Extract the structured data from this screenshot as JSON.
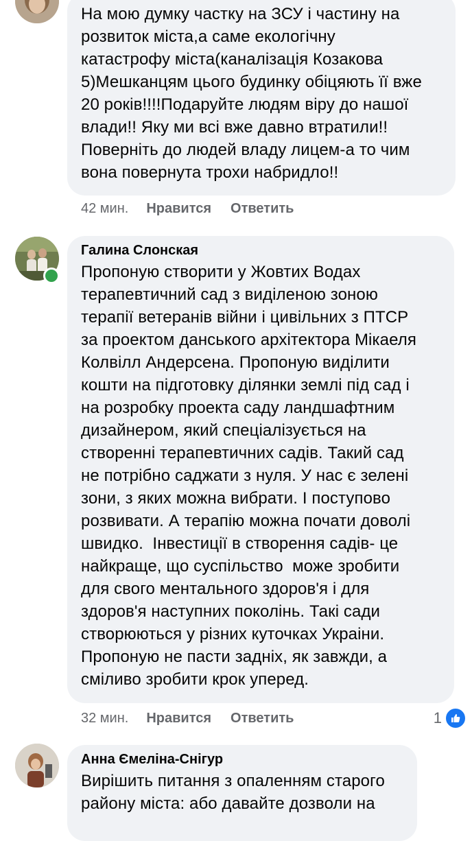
{
  "comments": [
    {
      "author": "",
      "text": "На мою думку частку на ЗСУ і частину на\nрозвиток міста,а саме екологічну\nкатастрофу міста(каналізація Козакова\n5)Мешканцям цього будинку обіцяють її вже\n20 років!!!!Подаруйте людям віру до нашої\nвлади!! Яку ми всі вже давно втратили!!\nПоверніть до людей владу лицем-а то чим\nвона повернута трохи набридло!!",
      "time": "42 мин.",
      "like_label": "Нравится",
      "reply_label": "Ответить"
    },
    {
      "author": "Галина Слонская",
      "online": true,
      "text": "Пропоную створити у Жовтих Водах\nтерапевтичний сад з виділеною зоною\nтерапії ветеранів війни і цивільних з ПТСР\nза проектом данського архітектора Мікаеля\nКолвілл Андерсена. Пропоную виділити\nкошти на підготовку ділянки землі під сад і\nна розробку проекта саду ландшафтним\nдизайнером, який спеціалізується на\nстворенні терапевтичних садів. Такий сад\nне потрібно саджати з нуля. У нас є зелені\nзони, з яких можна вибрати. І поступово\nрозвивати. А терапію можна почати доволі\nшвидко.  Інвестиції в створення садів- це\nнайкраще, що суспільство  може зробити\nдля свого ментального здоров'я і для\nздоров'я наступних поколінь. Такі сади\nстворюються у різних куточках Украіни.\nПропоную не пасти задніх, як завжди, а\nсміливо зробити крок уперед.",
      "time": "32 мин.",
      "like_label": "Нравится",
      "reply_label": "Ответить",
      "reaction_count": "1",
      "reaction_icon": "thumbs-up-icon"
    },
    {
      "author": "Анна Ємеліна-Снігур",
      "text": "Вирішить питання з опаленням старого\nрайону міста: або давайте дозволи на"
    }
  ],
  "colors": {
    "bubble": "#f0f2f5",
    "meta_text": "#65676b",
    "like_blue": "#1877f2",
    "online_green": "#31a24c"
  }
}
